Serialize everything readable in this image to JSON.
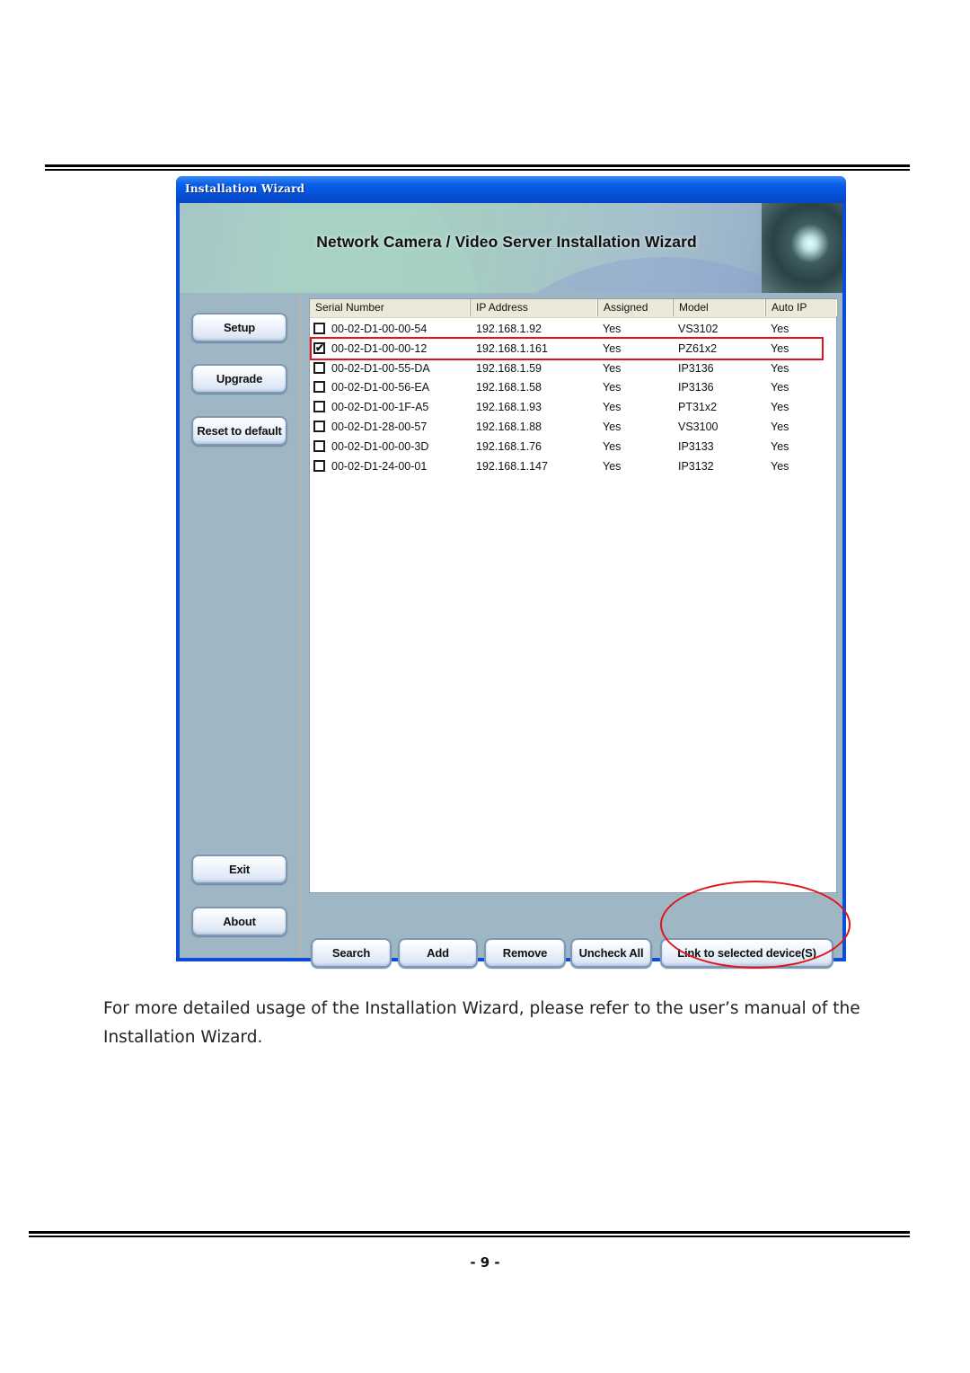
{
  "window": {
    "title": "Installation Wizard",
    "banner_title": "Network Camera / Video Server Installation Wizard"
  },
  "sidebar": {
    "buttons": [
      {
        "label": "Setup"
      },
      {
        "label": "Upgrade"
      },
      {
        "label": "Reset to default"
      },
      {
        "label": "Exit"
      },
      {
        "label": "About"
      }
    ]
  },
  "device_list": {
    "columns": [
      "Serial Number",
      "IP Address",
      "Assigned",
      "Model",
      "Auto IP"
    ],
    "rows": [
      {
        "checked": false,
        "serial": "00-02-D1-00-00-54",
        "ip": "192.168.1.92",
        "assigned": "Yes",
        "model": "VS3102",
        "auto_ip": "Yes"
      },
      {
        "checked": true,
        "serial": "00-02-D1-00-00-12",
        "ip": "192.168.1.161",
        "assigned": "Yes",
        "model": "PZ61x2",
        "auto_ip": "Yes"
      },
      {
        "checked": false,
        "serial": "00-02-D1-00-55-DA",
        "ip": "192.168.1.59",
        "assigned": "Yes",
        "model": "IP3136",
        "auto_ip": "Yes"
      },
      {
        "checked": false,
        "serial": "00-02-D1-00-56-EA",
        "ip": "192.168.1.58",
        "assigned": "Yes",
        "model": "IP3136",
        "auto_ip": "Yes"
      },
      {
        "checked": false,
        "serial": "00-02-D1-00-1F-A5",
        "ip": "192.168.1.93",
        "assigned": "Yes",
        "model": "PT31x2",
        "auto_ip": "Yes"
      },
      {
        "checked": false,
        "serial": "00-02-D1-28-00-57",
        "ip": "192.168.1.88",
        "assigned": "Yes",
        "model": "VS3100",
        "auto_ip": "Yes"
      },
      {
        "checked": false,
        "serial": "00-02-D1-00-00-3D",
        "ip": "192.168.1.76",
        "assigned": "Yes",
        "model": "IP3133",
        "auto_ip": "Yes"
      },
      {
        "checked": false,
        "serial": "00-02-D1-24-00-01",
        "ip": "192.168.1.147",
        "assigned": "Yes",
        "model": "IP3132",
        "auto_ip": "Yes"
      }
    ]
  },
  "bottom_buttons": [
    {
      "label": "Search"
    },
    {
      "label": "Add"
    },
    {
      "label": "Remove"
    },
    {
      "label": "Uncheck All"
    },
    {
      "label": "Link to selected device(S)"
    }
  ],
  "annotation_color": "#e0141c",
  "caption": "For more detailed usage of the Installation Wizard, please refer to the user’s manual of the Installation Wizard.",
  "page_number": "- 9 -"
}
